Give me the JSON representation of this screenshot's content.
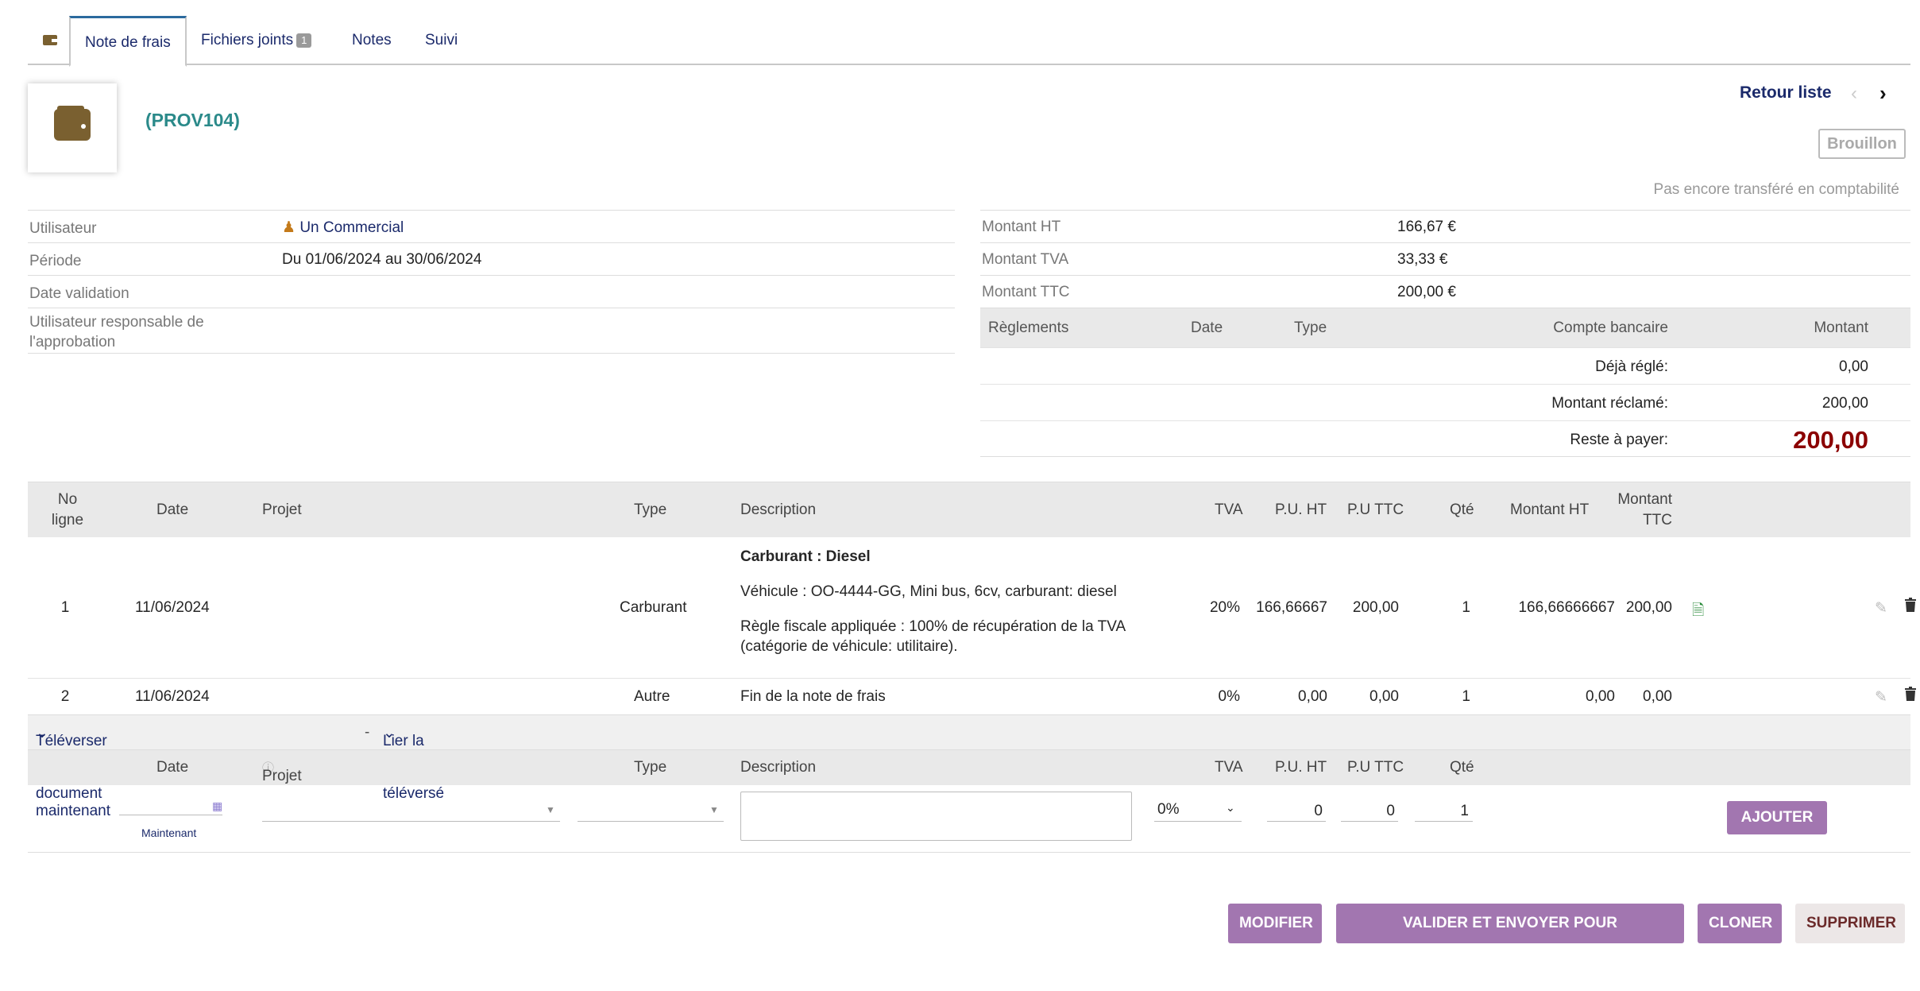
{
  "tabs": [
    {
      "label": "Note de frais"
    },
    {
      "label": "Fichiers joints",
      "badge": "1"
    },
    {
      "label": "Notes"
    },
    {
      "label": "Suivi"
    }
  ],
  "header": {
    "ref": "(PROV104)",
    "back_link": "Retour liste",
    "status": "Brouillon",
    "compta_status": "Pas encore transféré en comptabilité"
  },
  "fields": {
    "user_label": "Utilisateur",
    "user_value": "Un Commercial",
    "period_label": "Période",
    "period_value": "Du 01/06/2024 au 30/06/2024",
    "validation_label": "Date validation",
    "approver_label": "Utilisateur responsable de l'approbation"
  },
  "amounts": {
    "ht_label": "Montant HT",
    "ht_value": "166,67 €",
    "tva_label": "Montant TVA",
    "tva_value": "33,33 €",
    "ttc_label": "Montant TTC",
    "ttc_value": "200,00 €"
  },
  "payments": {
    "headers": [
      "Règlements",
      "Date",
      "Type",
      "Compte bancaire",
      "Montant"
    ],
    "already_label": "Déjà réglé:",
    "already_value": "0,00",
    "claimed_label": "Montant réclamé:",
    "claimed_value": "200,00",
    "remaining_label": "Reste à payer:",
    "remaining_value": "200,00"
  },
  "lines": {
    "headers": {
      "no": "No ligne",
      "date": "Date",
      "project": "Projet",
      "type": "Type",
      "description": "Description",
      "tva": "TVA",
      "pu_ht": "P.U. HT",
      "pu_ttc": "P.U TTC",
      "qty": "Qté",
      "montant_ht": "Montant HT",
      "montant_ttc": "Montant TTC"
    },
    "rows": [
      {
        "no": "1",
        "date": "11/06/2024",
        "type": "Carburant",
        "desc_title": "Carburant : Diesel",
        "desc_vehicle": "Véhicule : OO-4444-GG, Mini bus, 6cv, carburant: diesel",
        "desc_rule_1": "Règle fiscale appliquée : 100% de récupération de la TVA",
        "desc_rule_2": "(catégorie de véhicule: utilitaire).",
        "tva": "20%",
        "pu_ht": "166,66667",
        "pu_ttc": "200,00",
        "qty": "1",
        "montant_ht": "166,66666667",
        "montant_ttc": "200,00"
      },
      {
        "no": "2",
        "date": "11/06/2024",
        "type": "Autre",
        "desc_title": "Fin de la note de frais",
        "tva": "0%",
        "pu_ht": "0,00",
        "pu_ttc": "0,00",
        "qty": "1",
        "montant_ht": "0,00",
        "montant_ttc": "0,00"
      }
    ]
  },
  "upload": {
    "new_doc": "Téléverser un nouveau document maintenant",
    "sep": "-",
    "link_doc": "Lier la ligne à un document téléversé"
  },
  "add_form": {
    "headers": {
      "date": "Date",
      "project": "Projet",
      "type": "Type",
      "description": "Description",
      "tva": "TVA",
      "pu_ht": "P.U. HT",
      "pu_ttc": "P.U TTC",
      "qty": "Qté"
    },
    "now_label": "Maintenant",
    "tva_value": "0%",
    "pu_ht": "0",
    "pu_ttc": "0",
    "qty": "1",
    "add_button": "AJOUTER"
  },
  "actions": {
    "modify": "MODIFIER",
    "validate": "VALIDER ET ENVOYER POUR APPROBATION",
    "clone": "CLONER",
    "delete": "SUPPRIMER"
  },
  "colors": {
    "accent": "#a276b0",
    "link": "#1b2a6b",
    "ref": "#2b8a8a",
    "remaining": "#8b0000"
  }
}
